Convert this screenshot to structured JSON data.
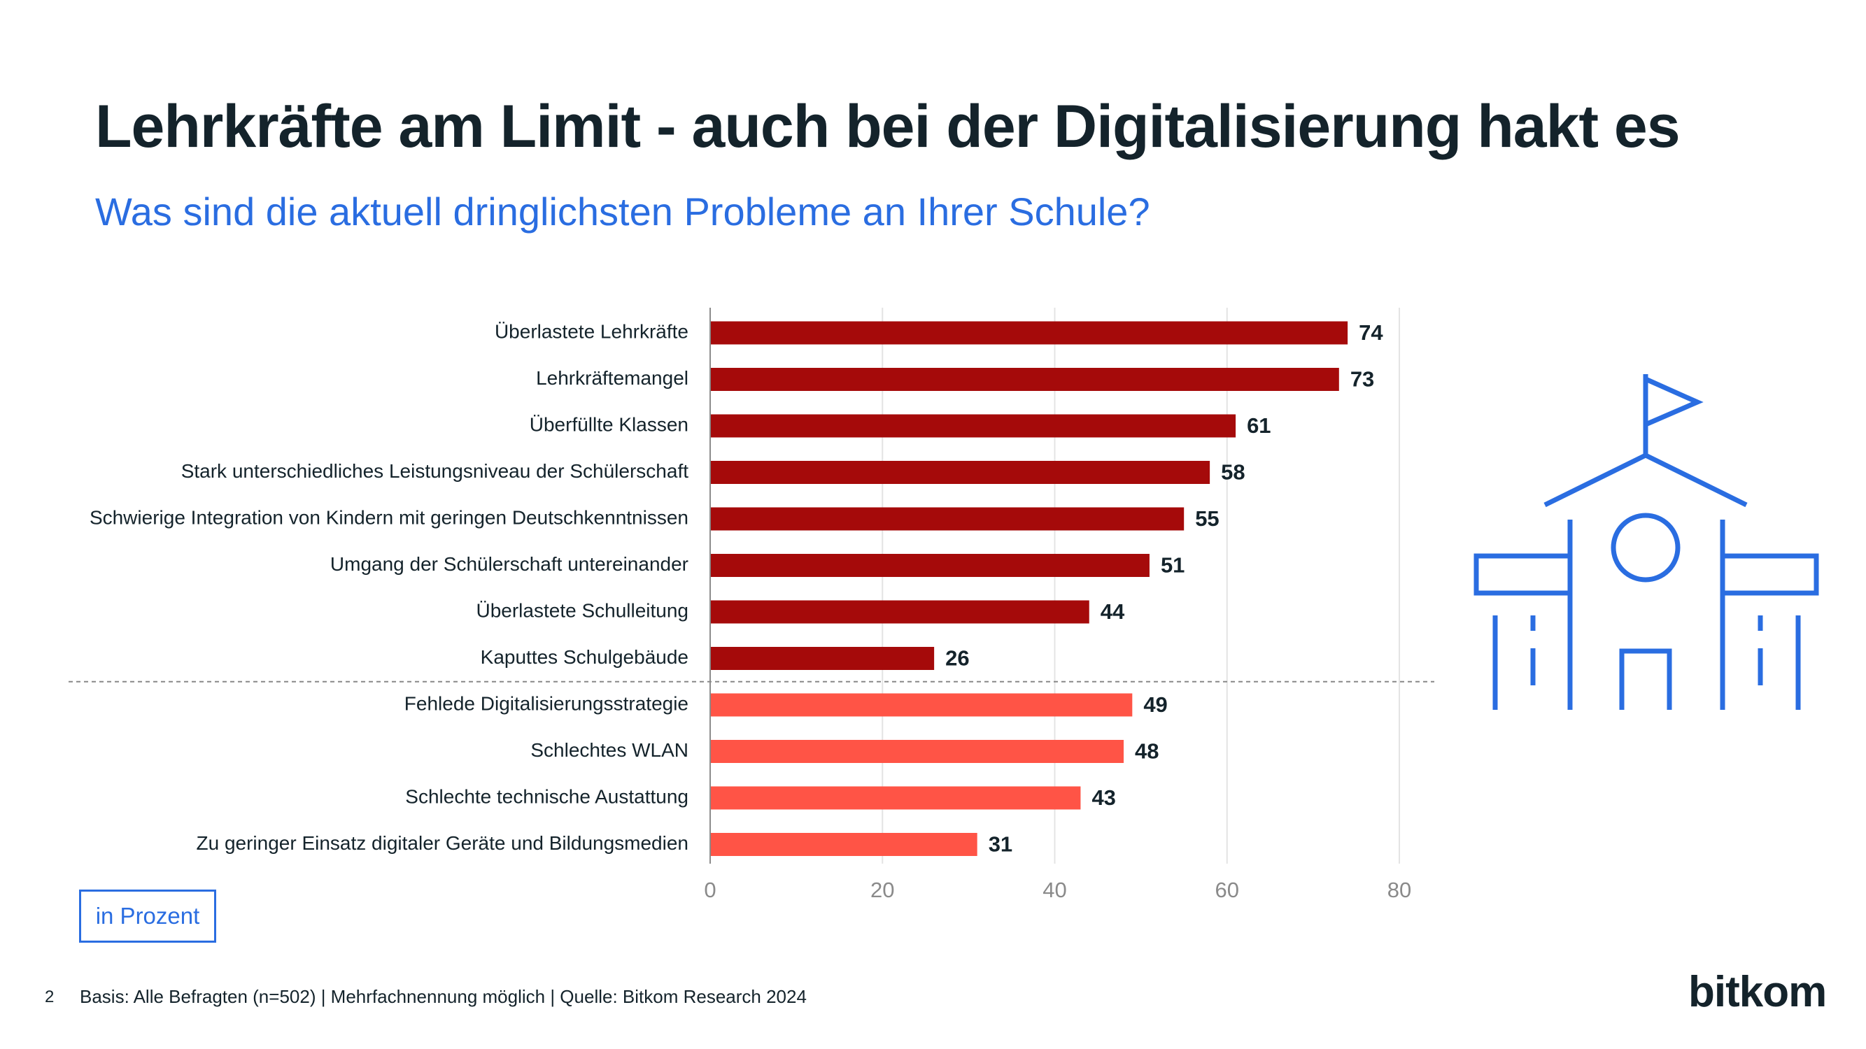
{
  "header": {
    "title": "Lehrkräfte am Limit - auch bei der Digitalisierung hakt es",
    "subtitle": "Was sind die aktuell dringlichsten Probleme an Ihrer Schule?"
  },
  "chart_data": {
    "type": "bar",
    "orientation": "horizontal",
    "categories": [
      "Überlastete Lehrkräfte",
      "Lehrkräftemangel",
      "Überfüllte Klassen",
      "Stark unterschiedliches Leistungsniveau der Schülerschaft",
      "Schwierige Integration von Kindern mit geringen Deutschkenntnissen",
      "Umgang der Schülerschaft untereinander",
      "Überlastete Schulleitung",
      "Kaputtes Schulgebäude",
      "Fehlede Digitalisierungsstrategie",
      "Schlechtes WLAN",
      "Schlechte technische Austattung",
      "Zu geringer Einsatz digitaler Geräte und Bildungsmedien"
    ],
    "values": [
      74,
      73,
      61,
      58,
      55,
      51,
      44,
      26,
      49,
      48,
      43,
      31
    ],
    "groups": [
      0,
      0,
      0,
      0,
      0,
      0,
      0,
      0,
      1,
      1,
      1,
      1
    ],
    "group_colors": [
      "#a50a0a",
      "#ff5446"
    ],
    "xlim": [
      0,
      80
    ],
    "xticks": [
      0,
      20,
      40,
      60,
      80
    ],
    "grid": true,
    "unit_label": "in Prozent"
  },
  "icon": {
    "name": "school-building-icon",
    "color": "#2a6de1"
  },
  "footer": {
    "page_number": "2",
    "source": "Basis: Alle Befragten (n=502) | Mehrfachnennung möglich | Quelle: Bitkom Research 2024",
    "logo": "bitkom"
  }
}
